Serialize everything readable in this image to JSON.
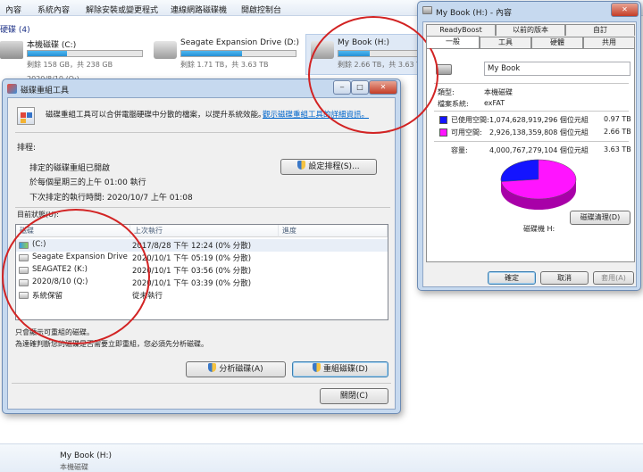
{
  "explorer": {
    "menu": [
      "內容",
      "系統內容",
      "解除安裝或變更程式",
      "連線網路磁碟機",
      "開啟控制台"
    ],
    "hdd_header": "硬碟 (4)",
    "drives": [
      {
        "name": "本機磁碟 (C:)",
        "free": "剩餘 158 GB，共 238 GB",
        "used_fraction": 0.34
      },
      {
        "name": "Seagate Expansion Drive (D:)",
        "free": "剩餘 1.71 TB，共 3.63 TB",
        "used_fraction": 0.53
      },
      {
        "name": "My Book (H:)",
        "free": "剩餘 2.66 TB，共 3.63 TB",
        "used_fraction": 0.27
      }
    ],
    "partial_drive": "2020/8/10 (Q:)",
    "bottom_name": "My Book (H:)",
    "bottom_type": "本機磁碟"
  },
  "defrag": {
    "title": "磁碟重組工具",
    "description": "磁碟重組工具可以合併電腦硬碟中分散的檔案，以提升系統效能。",
    "help_link": "觀示磁碟重組工具的詳細資訊。",
    "schedule_label": "排程:",
    "schedule_on": "排定的磁碟重組已開啟",
    "schedule_when": "於每個星期三的上午 01:00 執行",
    "schedule_next": "下次排定的執行時間: 2020/10/7 上午 01:08",
    "schedule_button": "設定排程(S)...",
    "status_label": "目前狀態(U):",
    "columns": [
      "磁碟",
      "上次執行",
      "進度"
    ],
    "rows": [
      {
        "disk": "(C:)",
        "last": "2017/8/28 下午 12:24 (0% 分散)",
        "progress": ""
      },
      {
        "disk": "Seagate Expansion Drive (...",
        "last": "2020/10/1 下午 05:19 (0% 分散)",
        "progress": ""
      },
      {
        "disk": "SEAGATE2 (K:)",
        "last": "2020/10/1 下午 03:56 (0% 分散)",
        "progress": ""
      },
      {
        "disk": "2020/8/10 (Q:)",
        "last": "2020/10/1 下午 03:39 (0% 分散)",
        "progress": ""
      },
      {
        "disk": "系統保留",
        "last": "從未執行",
        "progress": ""
      }
    ],
    "note1": "只會顯示可重組的磁碟。",
    "note2": "為達確判斷您的磁碟是否需要立即重組，您必須先分析磁碟。",
    "analyze_button": "分析磁碟(A)",
    "defrag_button": "重組磁碟(D)",
    "close_button": "關閉(C)"
  },
  "props": {
    "title": "My Book (H:) - 內容",
    "tabs_row1": [
      "ReadyBoost",
      "以前的版本",
      "自訂"
    ],
    "tabs_row2": [
      "一般",
      "工具",
      "硬體",
      "共用"
    ],
    "volume_name": "My Book",
    "type_label": "類型:",
    "type_value": "本機磁碟",
    "fs_label": "檔案系統:",
    "fs_value": "exFAT",
    "used_label": "已使用空間:",
    "used_bytes": "1,074,628,919,296 個位元組",
    "used_size": "0.97 TB",
    "free_label": "可用空間:",
    "free_bytes": "2,926,138,359,808 個位元組",
    "free_size": "2.66 TB",
    "capacity_label": "容量:",
    "capacity_bytes": "4,000,767,279,104 個位元組",
    "capacity_size": "3.63 TB",
    "disk_label": "磁碟機 H:",
    "cleanup_button": "磁碟清理(D)",
    "ok_button": "確定",
    "cancel_button": "取消",
    "apply_button": "套用(A)",
    "used_fraction": 0.2686
  },
  "colors": {
    "used": "#1414ff",
    "free": "#ff14ff",
    "annotation": "#d22323"
  }
}
